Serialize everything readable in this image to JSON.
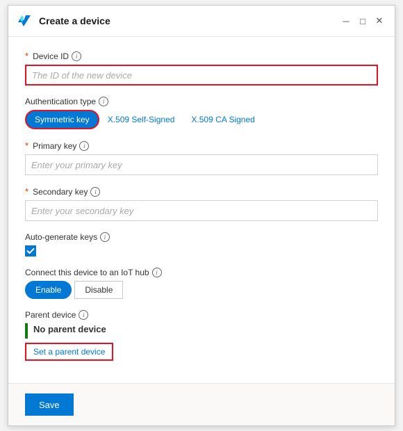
{
  "window": {
    "title": "Create a device",
    "minimize_label": "minimize",
    "maximize_label": "maximize",
    "close_label": "close"
  },
  "form": {
    "device_id": {
      "label": "Device ID",
      "required": true,
      "placeholder": "The ID of the new device",
      "value": ""
    },
    "auth_type": {
      "label": "Authentication type",
      "options": [
        {
          "id": "symmetric",
          "label": "Symmetric key",
          "active": true
        },
        {
          "id": "x509_self",
          "label": "X.509 Self-Signed",
          "active": false
        },
        {
          "id": "x509_ca",
          "label": "X.509 CA Signed",
          "active": false
        }
      ]
    },
    "primary_key": {
      "label": "Primary key",
      "required": true,
      "placeholder": "Enter your primary key",
      "value": ""
    },
    "secondary_key": {
      "label": "Secondary key",
      "required": true,
      "placeholder": "Enter your secondary key",
      "value": ""
    },
    "auto_generate": {
      "label": "Auto-generate keys",
      "checked": true
    },
    "connect_iot": {
      "label": "Connect this device to an IoT hub",
      "options": [
        {
          "id": "enable",
          "label": "Enable",
          "active": true
        },
        {
          "id": "disable",
          "label": "Disable",
          "active": false
        }
      ]
    },
    "parent_device": {
      "label": "Parent device",
      "value": "No parent device",
      "action_label": "Set a parent device"
    }
  },
  "footer": {
    "save_label": "Save"
  }
}
